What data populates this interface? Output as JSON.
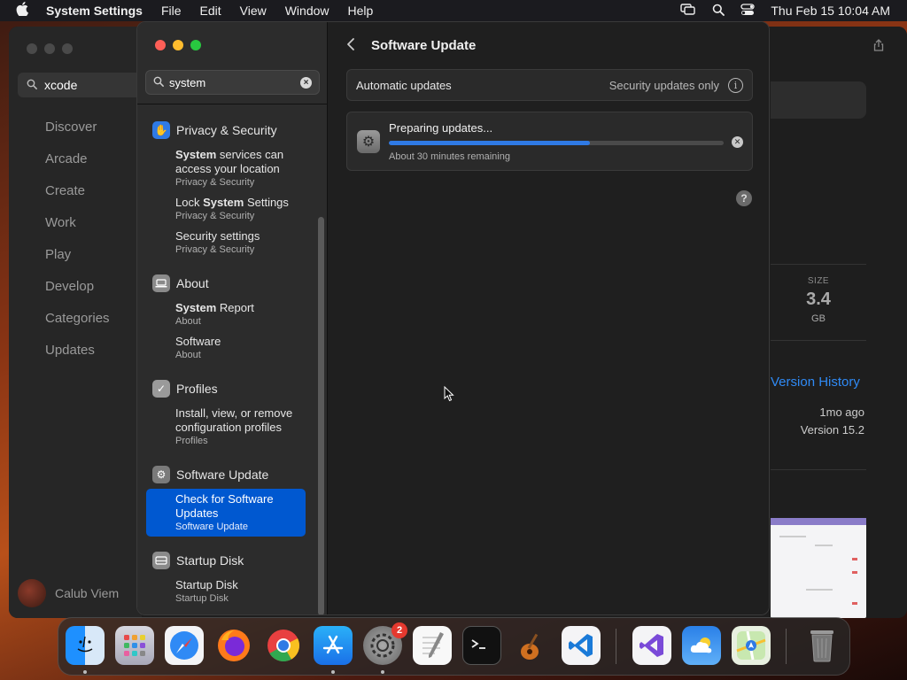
{
  "menubar": {
    "app_name": "System Settings",
    "items": [
      "File",
      "Edit",
      "View",
      "Window",
      "Help"
    ],
    "clock": "Thu Feb 15  10:04 AM"
  },
  "appstore": {
    "search_value": "xcode",
    "nav": [
      "Discover",
      "Arcade",
      "Create",
      "Work",
      "Play",
      "Develop",
      "Categories",
      "Updates"
    ],
    "user_name": "Calub Viem",
    "size_label": "SIZE",
    "size_value": "3.4",
    "size_unit": "GB",
    "version_history": "Version History",
    "updated_ago": "1mo ago",
    "version": "Version 15.2"
  },
  "settings": {
    "search_value": "system",
    "groups": {
      "privacy": {
        "header": "Privacy & Security",
        "r1": {
          "pre": "",
          "hl": "System",
          "post": " services can access your location",
          "sub": "Privacy & Security"
        },
        "r2": {
          "pre": "Lock ",
          "hl": "System",
          "post": " Settings",
          "sub": "Privacy & Security"
        },
        "r3": {
          "title": "Security settings",
          "sub": "Privacy & Security"
        }
      },
      "about": {
        "header": "About",
        "r1": {
          "hl": "System",
          "post": " Report",
          "sub": "About"
        },
        "r2": {
          "title": "Software",
          "sub": "About"
        }
      },
      "profiles": {
        "header": "Profiles",
        "r1": {
          "title": "Install, view, or remove configuration profiles",
          "sub": "Profiles"
        }
      },
      "software_update": {
        "header": "Software Update",
        "r1": {
          "title": "Check for Software Updates",
          "sub": "Software Update"
        }
      },
      "startup": {
        "header": "Startup Disk",
        "r1": {
          "title": "Startup Disk",
          "sub": "Startup Disk"
        }
      }
    },
    "main": {
      "title": "Software Update",
      "auto_label": "Automatic updates",
      "auto_value": "Security updates only",
      "prep_title": "Preparing updates...",
      "prep_remaining": "About 30 minutes remaining",
      "progress": 0.6
    }
  },
  "dock": {
    "settings_badge": "2"
  },
  "colors": {
    "accent": "#0058d0",
    "progress": "#2f7ae5",
    "link": "#2f8af5"
  }
}
